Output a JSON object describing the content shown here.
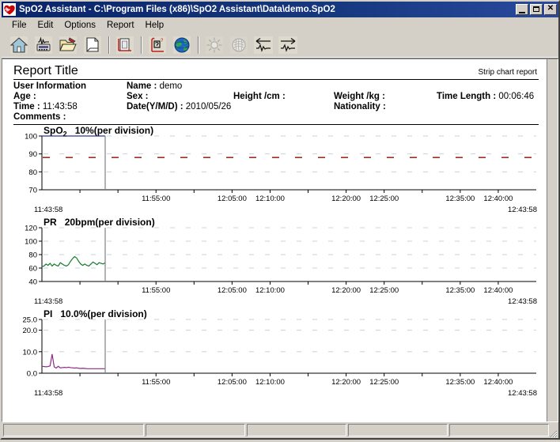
{
  "window": {
    "title": "SpO2 Assistant  -  C:\\Program Files (x86)\\SpO2 Assistant\\Data\\demo.SpO2",
    "app_icon": "heart-waveform-icon",
    "buttons": {
      "minimize": "_",
      "maximize": "□",
      "close": "✕"
    }
  },
  "menu": {
    "items": [
      {
        "label": "File"
      },
      {
        "label": "Edit"
      },
      {
        "label": "Options"
      },
      {
        "label": "Report"
      },
      {
        "label": "Help"
      }
    ]
  },
  "toolbar": {
    "buttons": [
      {
        "name": "home-icon",
        "tip": "Home",
        "enabled": true
      },
      {
        "name": "device-icon",
        "tip": "Device",
        "enabled": true
      },
      {
        "name": "open-folder-icon",
        "tip": "Open",
        "enabled": true
      },
      {
        "name": "print-icon",
        "tip": "Print",
        "enabled": true
      },
      {
        "name": "report-chart-icon",
        "tip": "Report",
        "enabled": true
      },
      {
        "name": "analysis-icon",
        "tip": "Analysis",
        "enabled": true
      },
      {
        "name": "globe-icon",
        "tip": "Web",
        "enabled": true
      },
      {
        "name": "sun-icon",
        "tip": "Brightness",
        "enabled": false
      },
      {
        "name": "network-icon",
        "tip": "Network",
        "enabled": false
      },
      {
        "name": "prev-wave-icon",
        "tip": "Previous",
        "enabled": true
      },
      {
        "name": "next-wave-icon",
        "tip": "Next",
        "enabled": true
      }
    ]
  },
  "report": {
    "title": "Report Title",
    "kind_label": "Strip chart report",
    "info": {
      "section_label": "User Information",
      "name_label": "Name :",
      "name_value": "demo",
      "age_label": "Age :",
      "age_value": "",
      "sex_label": "Sex :",
      "sex_value": "",
      "height_label": "Height /cm :",
      "height_value": "",
      "weight_label": "Weight /kg :",
      "weight_value": "",
      "time_length_label": "Time Length :",
      "time_length_value": "00:06:46",
      "time_label": "Time :",
      "time_value": "11:43:58",
      "date_label": "Date(Y/M/D) :",
      "date_value": "2010/05/26",
      "nationality_label": "Nationality :",
      "nationality_value": "",
      "comments_label": "Comments :",
      "comments_value": ""
    }
  },
  "chart_data": [
    {
      "type": "line",
      "name": "spo2-chart",
      "title": "SpO",
      "title_sub": "2",
      "title_unit": "10%(per division)",
      "ylabel": "",
      "ylim": [
        70,
        100
      ],
      "yticks": [
        70,
        80,
        90,
        100
      ],
      "ytick_labels": [
        "70",
        "80",
        "90",
        "100"
      ],
      "xlim_start": "11:43:58",
      "xlim_end": "12:43:58",
      "xticks": [
        "11:45:00",
        "11:50:00",
        "11:55:00",
        "12:00:00",
        "12:05:00",
        "12:10:00",
        "12:15:00",
        "12:20:00",
        "12:25:00",
        "12:30:00",
        "12:35:00",
        "12:40:00"
      ],
      "xtick_labels": [
        "",
        "",
        "11:55:00",
        "",
        "12:05:00",
        "12:10:00",
        "",
        "12:20:00",
        "12:25:00",
        "",
        "12:35:00",
        "12:40:00"
      ],
      "grid": true,
      "color": "#2b3a8f",
      "threshold": {
        "value": 88,
        "color": "#a03020",
        "style": "dashed"
      },
      "cursor_x_frac": 0.128,
      "data_end_frac": 0.128,
      "values": [
        100,
        100,
        100,
        100,
        100,
        100,
        100,
        100,
        100,
        100,
        100,
        100,
        100,
        100,
        100,
        100,
        100,
        100,
        100,
        100
      ]
    },
    {
      "type": "line",
      "name": "pr-chart",
      "title": "PR",
      "title_sub": "",
      "title_unit": "20bpm(per division)",
      "ylabel": "",
      "ylim": [
        40,
        120
      ],
      "yticks": [
        40,
        60,
        80,
        100,
        120
      ],
      "ytick_labels": [
        "40",
        "60",
        "80",
        "100",
        "120"
      ],
      "xlim_start": "11:43:58",
      "xlim_end": "12:43:58",
      "xticks": [
        "11:45:00",
        "11:50:00",
        "11:55:00",
        "12:00:00",
        "12:05:00",
        "12:10:00",
        "12:15:00",
        "12:20:00",
        "12:25:00",
        "12:30:00",
        "12:35:00",
        "12:40:00"
      ],
      "xtick_labels": [
        "",
        "",
        "11:55:00",
        "",
        "12:05:00",
        "12:10:00",
        "",
        "12:20:00",
        "12:25:00",
        "",
        "12:35:00",
        "12:40:00"
      ],
      "grid": true,
      "color": "#157a2e",
      "cursor_x_frac": 0.128,
      "data_end_frac": 0.128,
      "values": [
        62,
        63,
        66,
        64,
        67,
        63,
        66,
        64,
        63,
        68,
        66,
        64,
        63,
        65,
        70,
        74,
        77,
        75,
        70,
        66,
        64,
        66,
        64,
        63,
        66,
        69,
        67,
        65,
        68,
        67,
        66,
        68
      ]
    },
    {
      "type": "line",
      "name": "pi-chart",
      "title": "PI",
      "title_sub": "",
      "title_unit": "10.0%(per division)",
      "ylabel": "",
      "ylim": [
        0,
        25
      ],
      "yticks": [
        0,
        10,
        20,
        25
      ],
      "ytick_labels": [
        "0.0",
        "10.0",
        "20.0",
        "25.0"
      ],
      "xlim_start": "11:43:58",
      "xlim_end": "12:43:58",
      "xticks": [
        "11:45:00",
        "11:50:00",
        "11:55:00",
        "12:00:00",
        "12:05:00",
        "12:10:00",
        "12:15:00",
        "12:20:00",
        "12:25:00",
        "12:30:00",
        "12:35:00",
        "12:40:00"
      ],
      "xtick_labels": [
        "",
        "",
        "11:55:00",
        "",
        "12:05:00",
        "12:10:00",
        "",
        "12:20:00",
        "12:25:00",
        "",
        "12:35:00",
        "12:40:00"
      ],
      "grid": true,
      "color": "#8e2a84",
      "cursor_x_frac": 0.128,
      "data_end_frac": 0.128,
      "values": [
        3.2,
        3.1,
        3.0,
        3.1,
        3.4,
        8.9,
        3.0,
        2.4,
        3.2,
        2.5,
        2.6,
        2.7,
        2.6,
        2.8,
        2.6,
        2.5,
        2.4,
        2.5,
        2.3,
        2.2,
        2.3,
        2.2,
        2.1,
        2.1,
        2.1,
        2.1,
        2.1,
        2.1,
        2.1,
        2.1,
        2.1,
        2.1
      ]
    }
  ],
  "statusbar": {
    "panels": [
      "",
      "",
      "",
      "",
      ""
    ]
  }
}
